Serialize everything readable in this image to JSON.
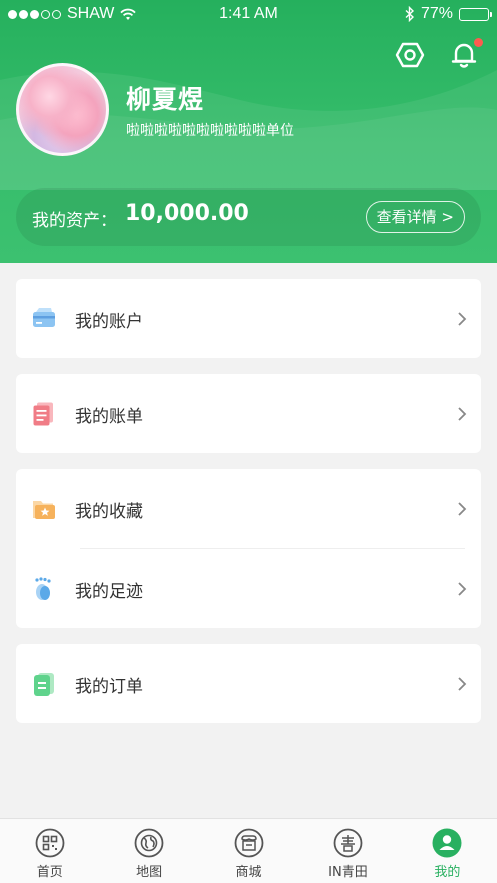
{
  "status_bar": {
    "carrier": "SHAW",
    "time": "1:41 AM",
    "battery_text": "77%",
    "battery_level": 0.77
  },
  "profile": {
    "name": "柳夏煜",
    "organization": "啦啦啦啦啦啦啦啦啦啦单位",
    "notification_unread": true
  },
  "assets": {
    "label": "我的资产：",
    "value": "10,000.00",
    "details_button": "查看详情 >"
  },
  "menu": {
    "account": {
      "label": "我的账户",
      "icon": "card-icon",
      "color": "#7ab8ee"
    },
    "bill": {
      "label": "我的账单",
      "icon": "bill-icon",
      "color": "#f07c86"
    },
    "favorites": {
      "label": "我的收藏",
      "icon": "folder-star-icon",
      "color": "#f6b25c"
    },
    "footprints": {
      "label": "我的足迹",
      "icon": "footprint-icon",
      "color": "#5ba9e8"
    },
    "orders": {
      "label": "我的订单",
      "icon": "order-icon",
      "color": "#5fd38c"
    }
  },
  "tabbar": {
    "items": [
      {
        "label": "首页",
        "icon": "qrcode-icon"
      },
      {
        "label": "地图",
        "icon": "globe-icon"
      },
      {
        "label": "商城",
        "icon": "shop-icon"
      },
      {
        "label": "IN青田",
        "icon": "qingtian-icon"
      },
      {
        "label": "我的",
        "icon": "user-icon",
        "active": true
      }
    ]
  },
  "colors": {
    "brand_green": "#2db463",
    "active_tab": "#28b060",
    "notification_dot": "#ff5b4f"
  }
}
